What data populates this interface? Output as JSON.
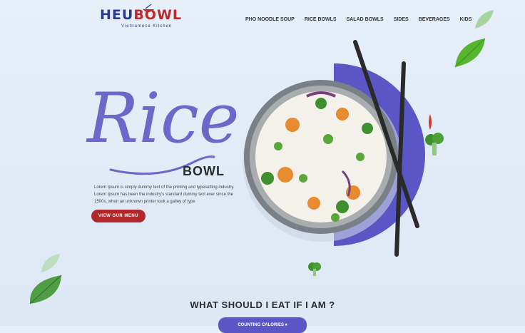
{
  "brand": {
    "name_part1": "HEU",
    "name_part2": "BOWL",
    "tagline": "Vietnamese Kitchen"
  },
  "nav": {
    "items": [
      "PHO NOODLE SOUP",
      "RICE BOWLS",
      "SALAD BOWLS",
      "SIDES",
      "BEVERAGES",
      "KIDS"
    ]
  },
  "hero": {
    "script_title": "Rice",
    "subtitle": "BOWL",
    "description": "Lorem Ipsum is simply dummy text of the printing and typesetting industry. Lorem Ipsum has been the industry's standard dummy text ever since the 1500s, when an unknown printer took a galley of type",
    "cta": "VIEW OUR MENU"
  },
  "section": {
    "title": "WHAT SHOULD I EAT  IF I AM ?",
    "button": "COUNTING CALORIES"
  },
  "colors": {
    "accent": "#5b56c6",
    "cta": "#b0282c",
    "script": "#6d67c9"
  }
}
